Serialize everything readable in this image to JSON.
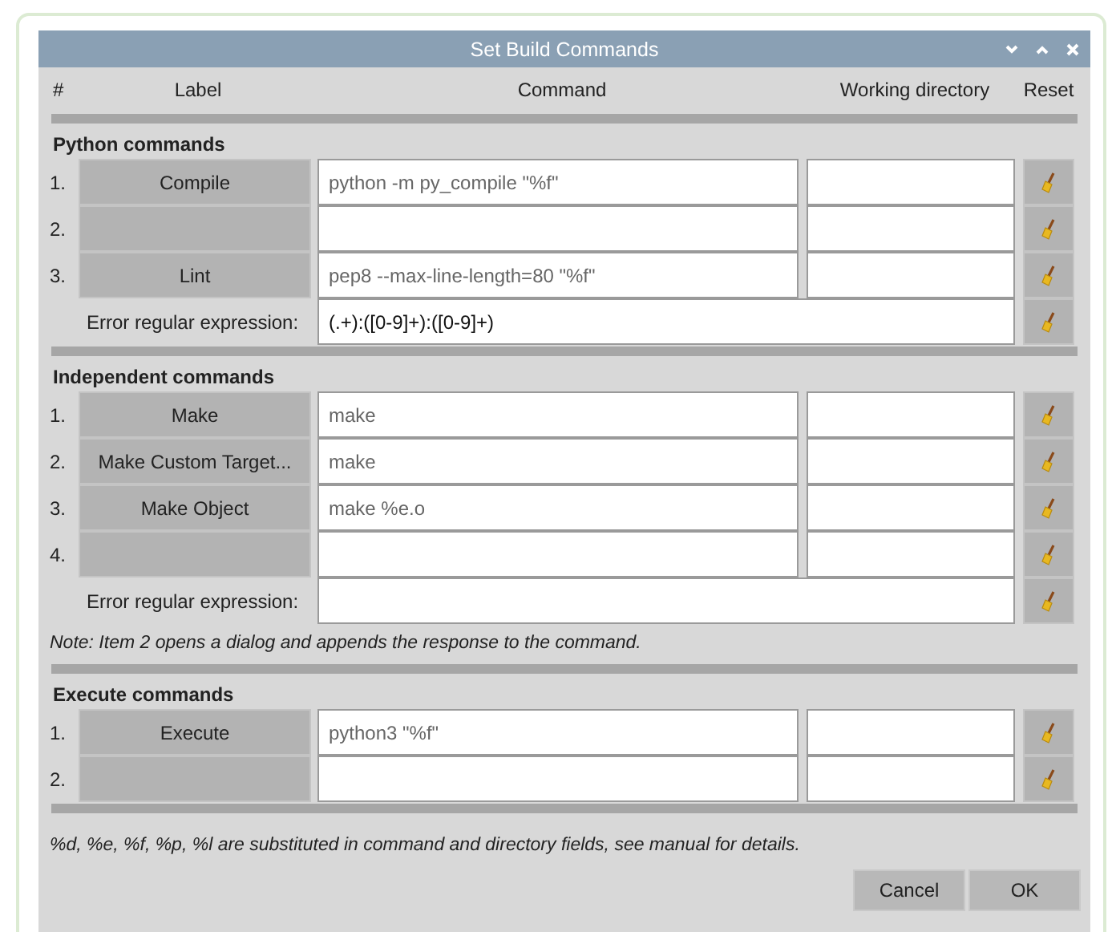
{
  "window": {
    "title": "Set Build Commands"
  },
  "columns": [
    "#",
    "Label",
    "Command",
    "Working directory",
    "Reset"
  ],
  "sections": [
    {
      "title": "Python commands",
      "commands": [
        {
          "number": "1.",
          "label": "Compile",
          "command": "python -m py_compile \"%f\""
        },
        {
          "number": "2."
        },
        {
          "number": "3.",
          "label": "Lint",
          "command": "pep8 --max-line-length=80 \"%f\""
        }
      ],
      "error_regex": {
        "label": "Error regular expression:",
        "value": "(.+):([0-9]+):([0-9]+)"
      }
    },
    {
      "title": "Independent commands",
      "commands": [
        {
          "number": "1.",
          "label": "Make",
          "command": "make"
        },
        {
          "number": "2.",
          "label": "Make Custom Target...",
          "command": "make"
        },
        {
          "number": "3.",
          "label": "Make Object",
          "command": "make %e.o"
        },
        {
          "number": "4."
        }
      ],
      "error_regex": {
        "label": "Error regular expression:"
      },
      "note": "Note: Item 2 opens a dialog and appends the response to the command."
    },
    {
      "title": "Execute commands",
      "commands": [
        {
          "number": "1.",
          "label": "Execute",
          "command": "python3 \"%f\""
        },
        {
          "number": "2."
        }
      ]
    }
  ],
  "footnote": "%d, %e, %f, %p, %l are substituted in command and directory fields, see manual for details.",
  "buttons": [
    "Cancel",
    "OK"
  ]
}
